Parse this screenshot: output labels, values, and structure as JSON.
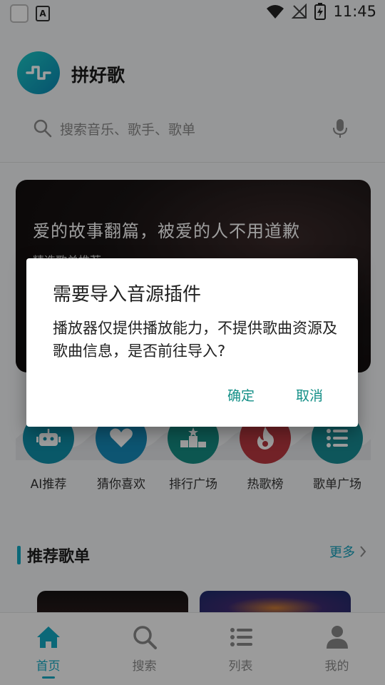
{
  "status_bar": {
    "time": "11:45"
  },
  "app": {
    "title": "拼好歌"
  },
  "search": {
    "placeholder": "搜索音乐、歌手、歌单"
  },
  "banner": {
    "title": "爱的故事翻篇，被爱的人不用道歉",
    "subtitle": "精选歌单推荐"
  },
  "categories": [
    {
      "label": "AI推荐",
      "icon": "robot-icon",
      "color": "#0f8ea9"
    },
    {
      "label": "猜你喜欢",
      "icon": "heart-icon",
      "color": "#1589b8"
    },
    {
      "label": "排行广场",
      "icon": "podium-icon",
      "color": "#148b82"
    },
    {
      "label": "热歌榜",
      "icon": "flame-icon",
      "color": "#b9373f"
    },
    {
      "label": "歌单广场",
      "icon": "list-icon",
      "color": "#188b94"
    }
  ],
  "recommend": {
    "title": "推荐歌单",
    "more": "更多"
  },
  "bottom_nav": [
    {
      "label": "首页",
      "icon": "home-icon",
      "active": true
    },
    {
      "label": "搜索",
      "icon": "search-icon",
      "active": false
    },
    {
      "label": "列表",
      "icon": "list-icon",
      "active": false
    },
    {
      "label": "我的",
      "icon": "person-icon",
      "active": false
    }
  ],
  "dialog": {
    "title": "需要导入音源插件",
    "message": "播放器仅提供播放能力，不提供歌曲资源及歌曲信息，是否前往导入?",
    "confirm": "确定",
    "cancel": "取消"
  },
  "colors": {
    "accent": "#12a8c2",
    "dialog_button": "#138f87"
  }
}
